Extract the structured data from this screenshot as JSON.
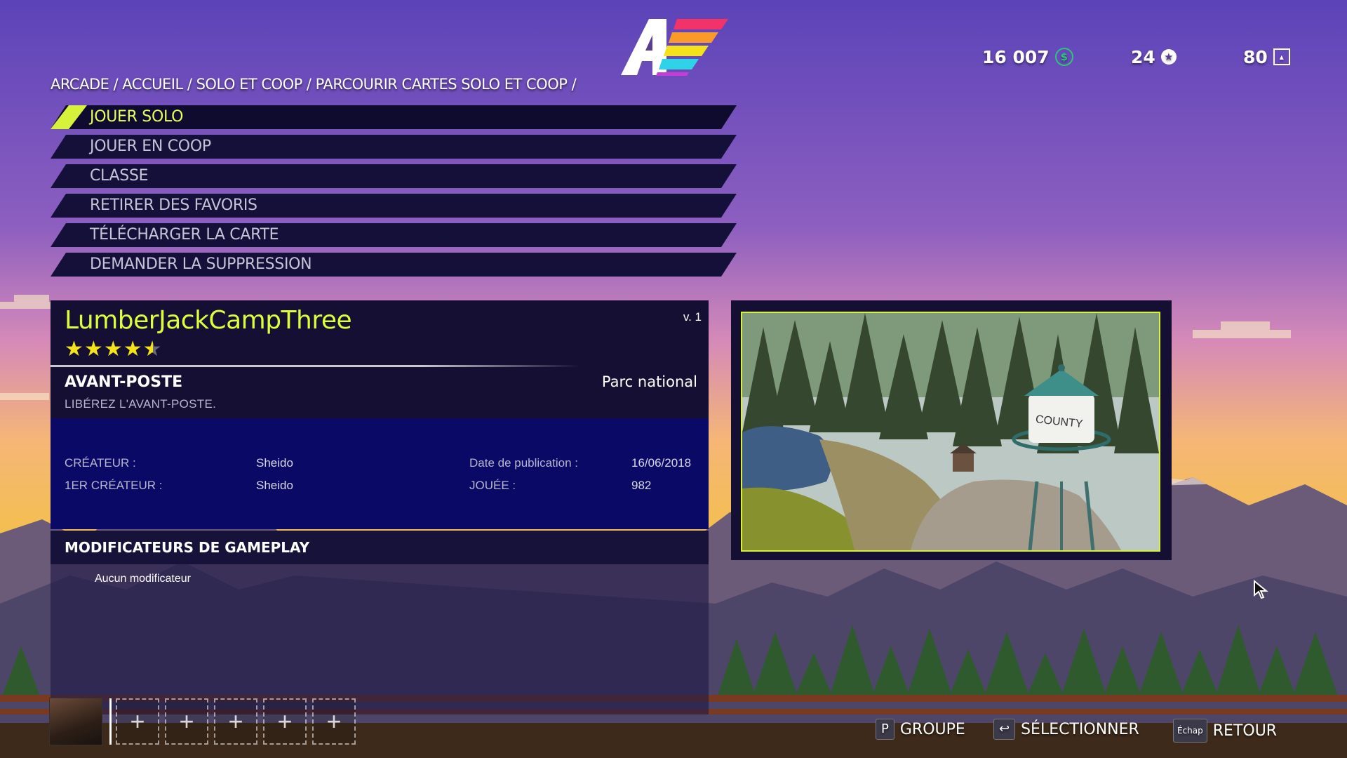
{
  "header": {
    "currency_value": "16 007",
    "stars_value": "24",
    "level_value": "80",
    "breadcrumb": "ARCADE / ACCUEIL / SOLO ET COOP / PARCOURIR CARTES SOLO ET COOP /"
  },
  "menu": {
    "items": [
      {
        "label": "JOUER SOLO",
        "selected": true
      },
      {
        "label": "JOUER EN COOP",
        "selected": false
      },
      {
        "label": "CLASSE",
        "selected": false
      },
      {
        "label": "RETIRER DES FAVORIS",
        "selected": false
      },
      {
        "label": "TÉLÉCHARGER LA CARTE",
        "selected": false
      },
      {
        "label": "DEMANDER LA SUPPRESSION",
        "selected": false
      }
    ]
  },
  "map": {
    "name": "LumberJackCampThree",
    "version": "v. 1",
    "rating": 4.5,
    "rating_stars": "★★★★★",
    "mode": "AVANT-POSTE",
    "biome": "Parc national",
    "objective": "LIBÉREZ L'AVANT-POSTE.",
    "creator_label": "CRÉATEUR :",
    "creator_value": "Sheido",
    "first_creator_label": "1ER CRÉATEUR :",
    "first_creator_value": "Sheido",
    "pub_date_label": "Date de publication :",
    "pub_date_value": "16/06/2018",
    "played_label": "JOUÉE :",
    "played_value": "982"
  },
  "modifiers": {
    "title": "MODIFICATEURS DE GAMEPLAY",
    "empty_text": "Aucun modificateur"
  },
  "preview": {
    "tower_text": "COUNTY"
  },
  "footer": {
    "group_key": "P",
    "group_label": "GROUPE",
    "select_key": "↩",
    "select_label": "SÉLECTIONNER",
    "back_key": "Échap",
    "back_label": "RETOUR",
    "slot_icon": "+"
  },
  "colors": {
    "accent": "#d7f23b",
    "panel": "#140f33",
    "details_panel": "#0a0966",
    "sky_top": "#5b43b8",
    "sky_bottom": "#f3c04a"
  }
}
